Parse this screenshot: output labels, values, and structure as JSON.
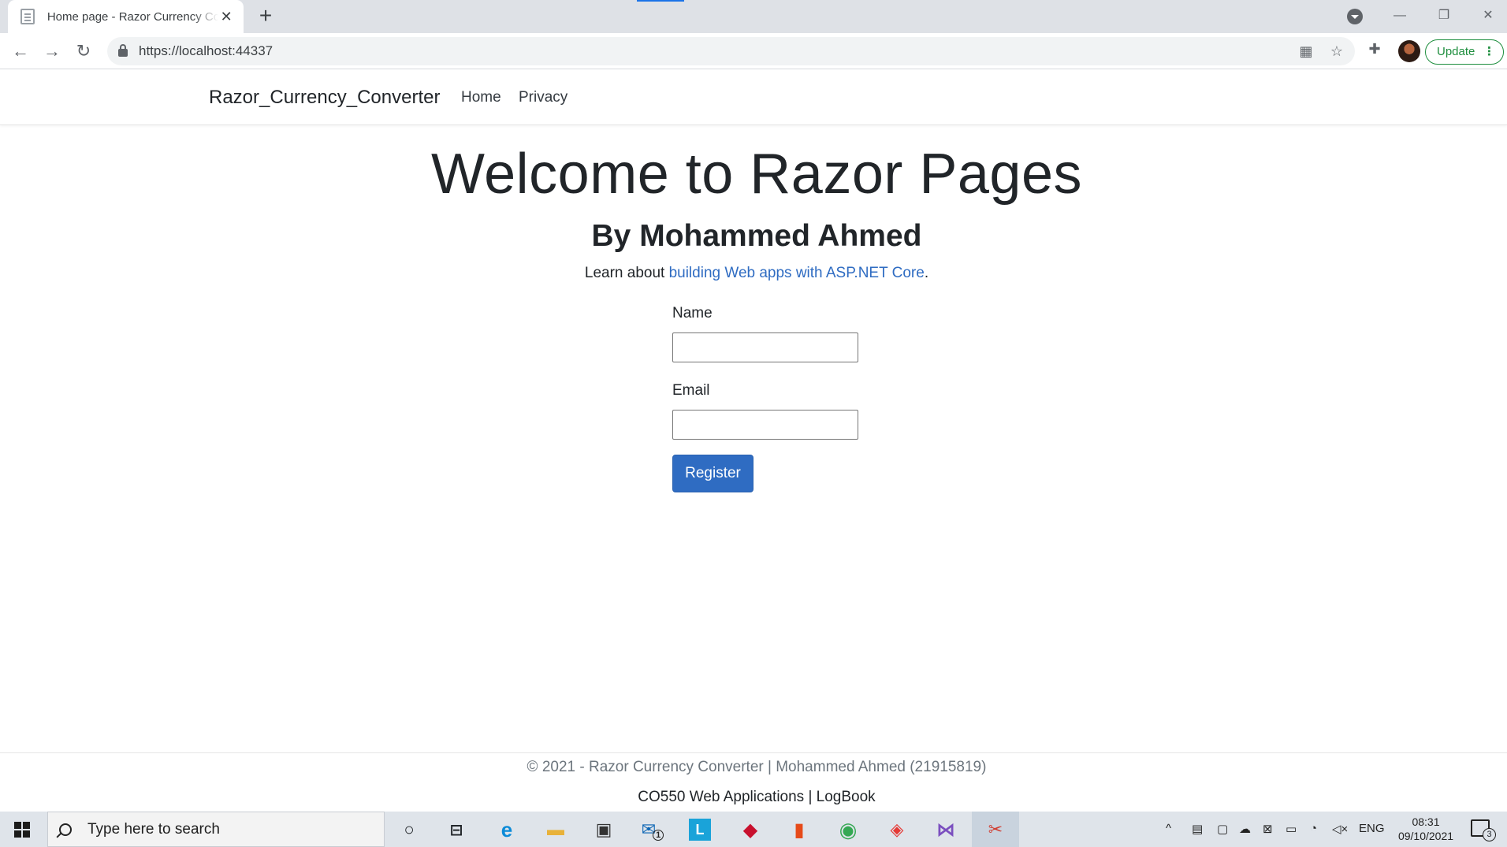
{
  "browser": {
    "tab_title": "Home page - Razor Currency Converter",
    "tab_close": "✕",
    "new_tab": "+",
    "url": "https://localhost:44337",
    "update_label": "Update",
    "minimize": "—",
    "restore": "❐",
    "close": "✕"
  },
  "site": {
    "brand": "Razor_Currency_Converter",
    "nav": [
      {
        "label": "Home"
      },
      {
        "label": "Privacy"
      }
    ],
    "heading": "Welcome to Razor Pages",
    "subheading": "By Mohammed Ahmed",
    "learn_prefix": "Learn about ",
    "learn_link": "building Web apps with ASP.NET Core",
    "learn_suffix": ".",
    "form": {
      "name_label": "Name",
      "name_value": "",
      "email_label": "Email",
      "email_value": "",
      "submit_label": "Register"
    },
    "footer": {
      "line1": "© 2021 - Razor Currency Converter | Mohammed Ahmed (21915819)",
      "line2": "CO550 Web Applications | LogBook"
    }
  },
  "taskbar": {
    "search_placeholder": "Type here to search",
    "mail_badge": "1",
    "language": "ENG",
    "time": "08:31",
    "date": "09/10/2021",
    "notifications": "3"
  },
  "colors": {
    "link": "#2f6cc2",
    "primary_button": "#2f6cc2",
    "update_green": "#1e8e3e"
  }
}
